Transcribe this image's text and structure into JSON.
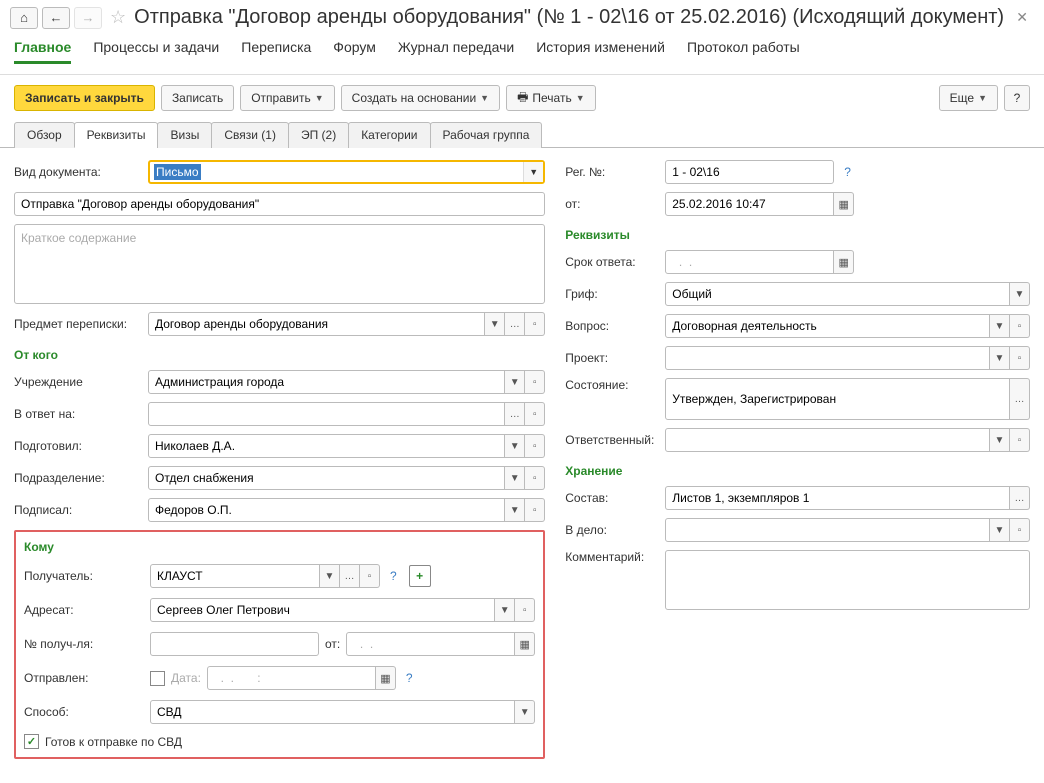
{
  "header": {
    "title": "Отправка \"Договор аренды оборудования\" (№ 1 - 02\\16 от 25.02.2016) (Исходящий документ)"
  },
  "maintabs": [
    "Главное",
    "Процессы и задачи",
    "Переписка",
    "Форум",
    "Журнал передачи",
    "История изменений",
    "Протокол работы"
  ],
  "cmd": {
    "save_close": "Записать и закрыть",
    "save": "Записать",
    "send": "Отправить",
    "create_based": "Создать на основании",
    "print": "Печать",
    "more": "Еще",
    "help": "?"
  },
  "subtabs": [
    "Обзор",
    "Реквизиты",
    "Визы",
    "Связи (1)",
    "ЭП (2)",
    "Категории",
    "Рабочая группа"
  ],
  "left": {
    "doc_type_label": "Вид документа:",
    "doc_type_value": "Письмо",
    "title_value": "Отправка \"Договор аренды оборудования\"",
    "short_placeholder": "Краткое содержание",
    "subject_label": "Предмет переписки:",
    "subject_value": "Договор аренды оборудования",
    "from_section": "От кого",
    "org_label": "Учреждение",
    "org_value": "Администрация города",
    "reply_label": "В ответ на:",
    "reply_value": "",
    "prepared_label": "Подготовил:",
    "prepared_value": "Николаев Д.А.",
    "dept_label": "Подразделение:",
    "dept_value": "Отдел снабжения",
    "signed_label": "Подписал:",
    "signed_value": "Федоров О.П.",
    "komu_section": "Кому",
    "recipient_label": "Получатель:",
    "recipient_value": "КЛАУСТ",
    "addressee_label": "Адресат:",
    "addressee_value": "Сергеев Олег Петрович",
    "recno_label": "№ получ-ля:",
    "recno_value": "",
    "recno_ot": "от:",
    "recno_date": "  .  .",
    "sent_label": "Отправлен:",
    "sent_date_label": "Дата:",
    "sent_date_value": "  .  .       :",
    "method_label": "Способ:",
    "method_value": "СВД",
    "ready_label": "Готов к отправке по СВД"
  },
  "right": {
    "regno_label": "Рег. №:",
    "regno_value": "1 - 02\\16",
    "ot_label": "от:",
    "ot_value": "25.02.2016 10:47",
    "rekv_section": "Реквизиты",
    "reply_term_label": "Срок ответа:",
    "reply_term_value": "  .  .",
    "grif_label": "Гриф:",
    "grif_value": "Общий",
    "question_label": "Вопрос:",
    "question_value": "Договорная деятельность",
    "project_label": "Проект:",
    "project_value": "",
    "state_label": "Состояние:",
    "state_value": "Утвержден, Зарегистрирован",
    "responsible_label": "Ответственный:",
    "responsible_value": "",
    "storage_section": "Хранение",
    "composition_label": "Состав:",
    "composition_value": "Листов 1, экземпляров 1",
    "case_label": "В дело:",
    "case_value": "",
    "comment_label": "Комментарий:"
  }
}
